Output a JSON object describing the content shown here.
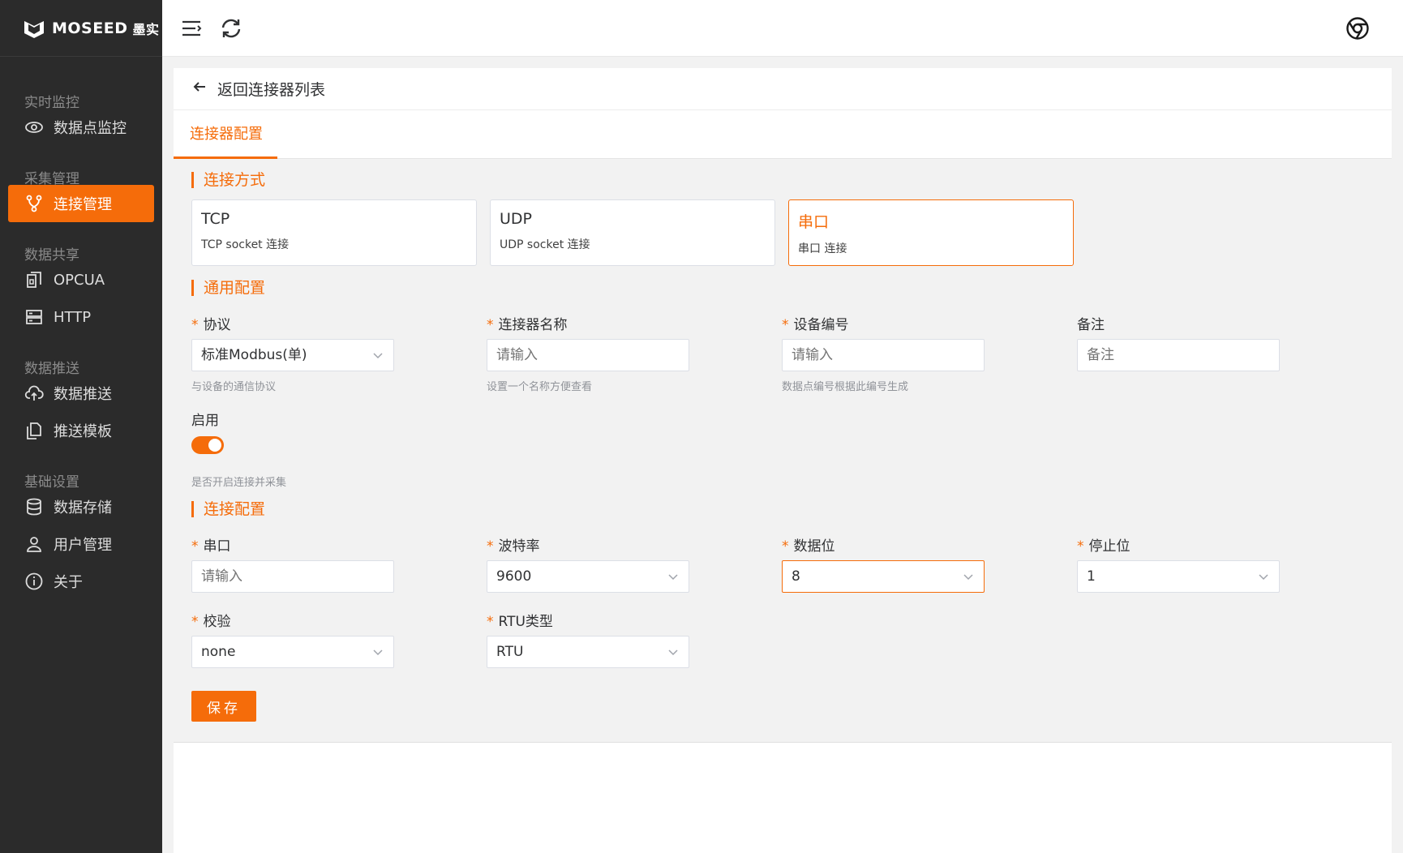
{
  "brand": {
    "name": "MOSEED",
    "cn": "墨实"
  },
  "sidebar": {
    "groups": [
      {
        "title": "实时监控",
        "items": [
          {
            "label": "数据点监控",
            "icon": "eye-icon"
          }
        ]
      },
      {
        "title": "采集管理",
        "items": [
          {
            "label": "连接管理",
            "icon": "branch-icon",
            "active": true
          }
        ]
      },
      {
        "title": "数据共享",
        "items": [
          {
            "label": "OPCUA",
            "icon": "opcua-icon"
          },
          {
            "label": "HTTP",
            "icon": "server-icon"
          }
        ]
      },
      {
        "title": "数据推送",
        "items": [
          {
            "label": "数据推送",
            "icon": "cloud-upload-icon"
          },
          {
            "label": "推送模板",
            "icon": "copy-icon"
          }
        ]
      },
      {
        "title": "基础设置",
        "items": [
          {
            "label": "数据存储",
            "icon": "database-icon"
          },
          {
            "label": "用户管理",
            "icon": "user-icon"
          },
          {
            "label": "关于",
            "icon": "info-icon"
          }
        ]
      }
    ]
  },
  "header": {
    "menu_icon": "menu-icon",
    "refresh_icon": "refresh-icon",
    "right_icon": "chrome-icon"
  },
  "back": {
    "label": "返回连接器列表"
  },
  "tabs": [
    {
      "label": "连接器配置",
      "active": true
    }
  ],
  "sections": {
    "mode": "连接方式",
    "general": "通用配置",
    "connection": "连接配置"
  },
  "modes": [
    {
      "title": "TCP",
      "desc": "TCP socket 连接",
      "selected": false
    },
    {
      "title": "UDP",
      "desc": "UDP socket 连接",
      "selected": false
    },
    {
      "title": "串口",
      "desc": "串口 连接",
      "selected": true
    }
  ],
  "general": {
    "protocol": {
      "label": "协议",
      "value": "标准Modbus(单)",
      "hint": "与设备的通信协议"
    },
    "name": {
      "label": "连接器名称",
      "placeholder": "请输入",
      "hint": "设置一个名称方便查看"
    },
    "device": {
      "label": "设备编号",
      "placeholder": "请输入",
      "hint": "数据点编号根据此编号生成"
    },
    "remark": {
      "label": "备注",
      "placeholder": "备注"
    },
    "enable": {
      "label": "启用",
      "on": true,
      "hint": "是否开启连接并采集"
    }
  },
  "connection": {
    "port": {
      "label": "串口",
      "placeholder": "请输入"
    },
    "baud": {
      "label": "波特率",
      "value": "9600"
    },
    "databits": {
      "label": "数据位",
      "value": "8"
    },
    "stopbits": {
      "label": "停止位",
      "value": "1"
    },
    "parity": {
      "label": "校验",
      "value": "none"
    },
    "rtu": {
      "label": "RTU类型",
      "value": "RTU"
    }
  },
  "save_label": "保存",
  "colors": {
    "accent": "#f56c0a",
    "sidebar": "#2b2b2b"
  }
}
